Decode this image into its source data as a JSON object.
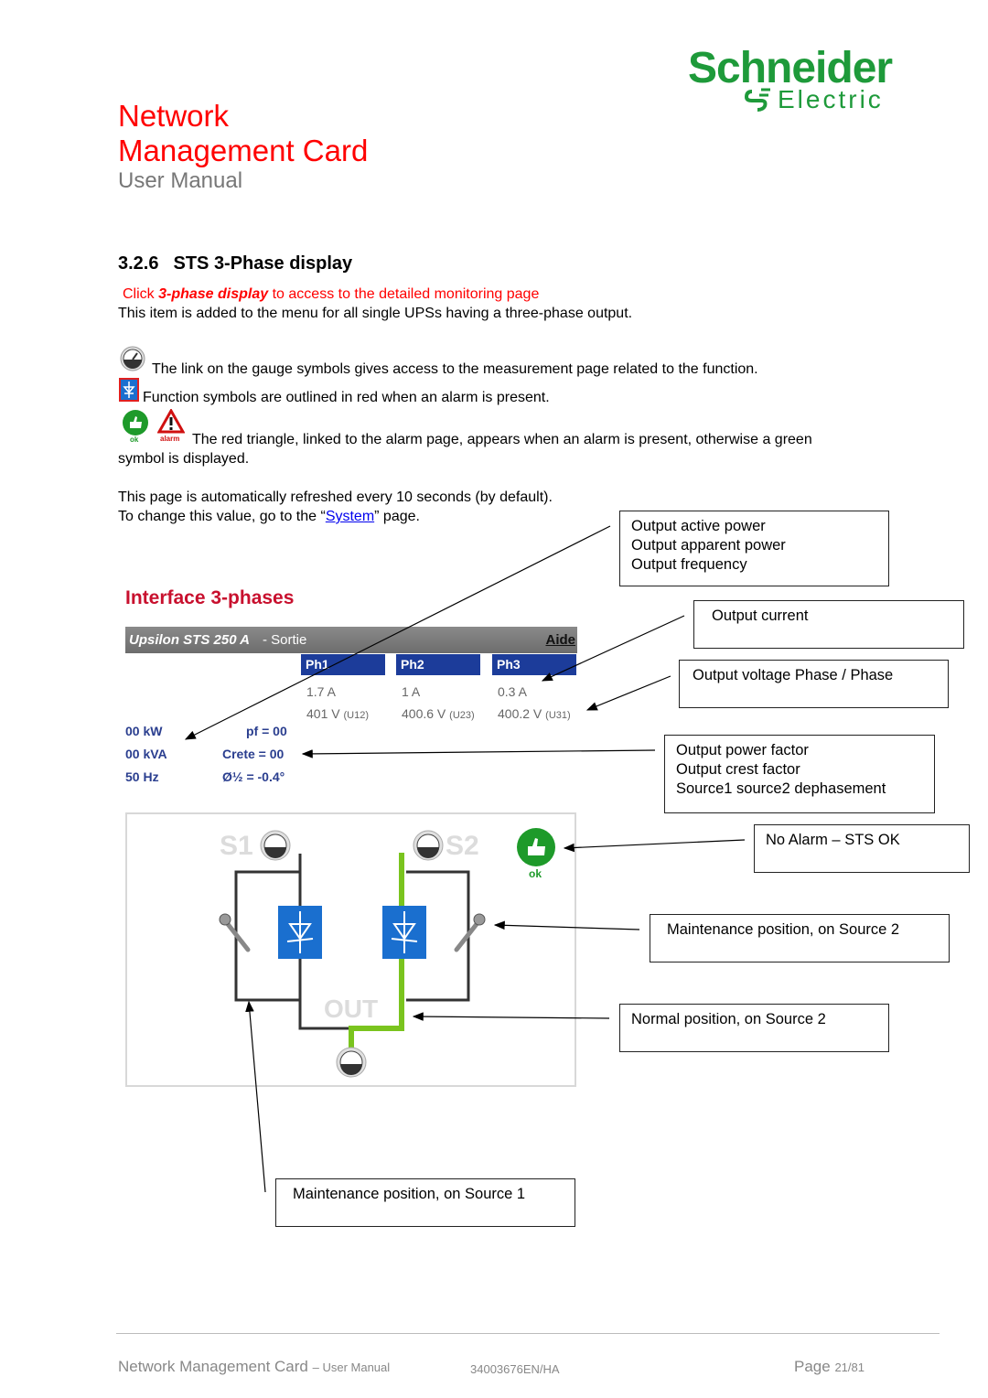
{
  "header": {
    "brand_line1": "Schneider",
    "brand_line2": "Electric",
    "title_line1": "Network",
    "title_line2": "Management Card",
    "subtitle": "User Manual"
  },
  "section": {
    "number": "3.2.6",
    "title": "STS 3-Phase display",
    "instruction_prefix": "Click ",
    "instruction_link": "3-phase display",
    "instruction_suffix": " to access to the detailed monitoring page",
    "intro": "This item is added to the menu for all single UPSs having a three-phase output.",
    "gauge_note": "The link on the gauge symbols gives access to the measurement page related to the function.",
    "function_note": "Function symbols are outlined in red when an alarm is present.",
    "alarm_note_line1": "The red triangle, linked to the alarm page, appears when an alarm is present, otherwise a green",
    "alarm_note_line2": "symbol is displayed.",
    "ok_label": "ok",
    "alarm_label": "alarm",
    "refresh_note": "This page is automatically refreshed every 10 seconds (by default).",
    "change_prefix": "To change this value, go to the “",
    "change_link": "System",
    "change_suffix": "” page."
  },
  "screenshot": {
    "title": "Interface 3-phases",
    "device": "Upsilon STS 250 A",
    "page": "- Sortie",
    "help": "Aide",
    "phases": [
      {
        "label": "Ph1",
        "current": "1.7 A",
        "voltage": "401 V",
        "voltage_ref": "(U12)"
      },
      {
        "label": "Ph2",
        "current": "1 A",
        "voltage": "400.6 V",
        "voltage_ref": "(U23)"
      },
      {
        "label": "Ph3",
        "current": "0.3 A",
        "voltage": "400.2 V",
        "voltage_ref": "(U31)"
      }
    ],
    "measures": {
      "kw": "00 kW",
      "kva": "00 kVA",
      "hz": "50 Hz",
      "pf": "pf = 00",
      "crest": "Crete = 00",
      "phase_shift": "Ø½ = -0.4°"
    },
    "diagram": {
      "source1": "S1",
      "source2": "S2",
      "output": "OUT",
      "status": "ok",
      "active_color": "#7ac41e",
      "inactive_color": "#333333",
      "switch_color": "#1a6fcf"
    }
  },
  "callouts": {
    "power": [
      "Output active power",
      "Output apparent power",
      "Output frequency"
    ],
    "current": "Output current",
    "voltage": "Output voltage Phase / Phase",
    "factors": [
      "Output power factor",
      "Output crest factor",
      "Source1 source2 dephasement"
    ],
    "no_alarm": "No Alarm – STS OK",
    "maint_s2": "Maintenance position, on Source 2",
    "normal_s2": "Normal position, on Source 2",
    "maint_s1": "Maintenance position, on Source 1"
  },
  "footer": {
    "doc_title": "Network Management Card",
    "doc_sub": "– User Manual",
    "doc_ref": "34003676EN/HA",
    "page_label": "Page",
    "page_num": "21/81"
  }
}
